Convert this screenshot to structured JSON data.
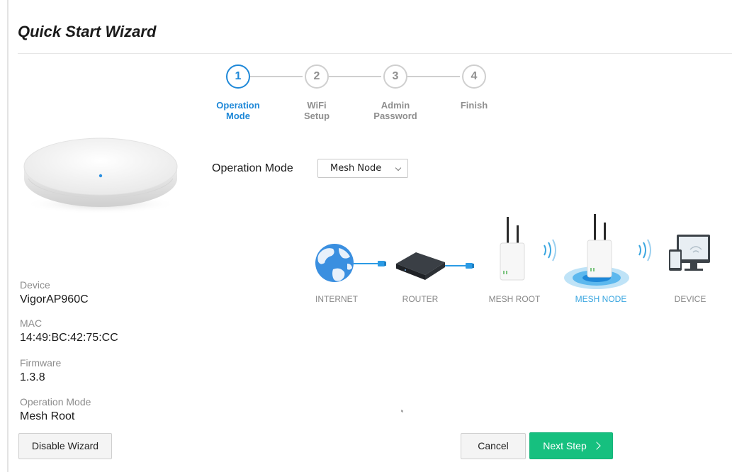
{
  "title": "Quick Start Wizard",
  "steps": [
    {
      "number": "1",
      "label_line1": "Operation",
      "label_line2": "Mode"
    },
    {
      "number": "2",
      "label_line1": "WiFi",
      "label_line2": "Setup"
    },
    {
      "number": "3",
      "label_line1": "Admin",
      "label_line2": "Password"
    },
    {
      "number": "4",
      "label_line1": "Finish",
      "label_line2": ""
    }
  ],
  "active_step": 1,
  "device_info": {
    "device_label": "Device",
    "device_value": "VigorAP960C",
    "mac_label": "MAC",
    "mac_value": "14:49:BC:42:75:CC",
    "firmware_label": "Firmware",
    "firmware_value": "1.3.8",
    "opmode_label": "Operation Mode",
    "opmode_value": "Mesh Root"
  },
  "operation_mode": {
    "label": "Operation Mode",
    "selected": "Mesh Node"
  },
  "topology": {
    "internet": "INTERNET",
    "router": "ROUTER",
    "mesh_root": "MESH ROOT",
    "mesh_node": "MESH NODE",
    "device": "DEVICE"
  },
  "buttons": {
    "disable_wizard": "Disable Wizard",
    "cancel": "Cancel",
    "next_step": "Next Step"
  },
  "colors": {
    "accent_blue": "#1e88d8",
    "next_green": "#16c07f",
    "inactive_gray": "#cfcfcf"
  }
}
